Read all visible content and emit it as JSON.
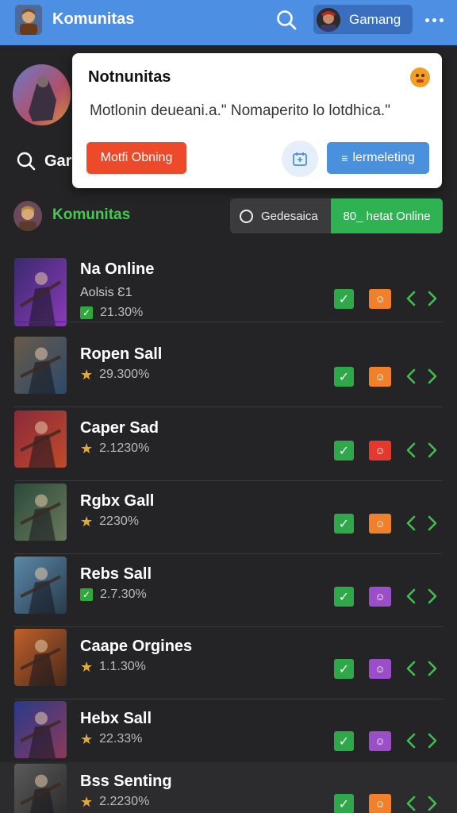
{
  "header": {
    "title": "Komunitas",
    "search_icon": "search-icon",
    "account_label": "Gamang",
    "more_icon": "more-horizontal-icon",
    "color": "#4d8fe3"
  },
  "background_search": {
    "text": "Gar"
  },
  "popup": {
    "title": "Notnunitas",
    "message": "Motlonin deueani.a.\" Nomaperito lo lotdhica.\"",
    "primary_button": "Motfi Obning",
    "calendar_icon": "calendar-icon",
    "secondary_button": "lermeleting",
    "secondary_icon": "list-icon"
  },
  "community": {
    "title": "Komunitas",
    "toggle_left": "Gedesaica",
    "toggle_right": "80_ hetat Online",
    "accent": "#46c954"
  },
  "rows": [
    {
      "name": "Na Online",
      "subtitle": "Aolsis Ɛ1",
      "stat": "21.30%",
      "stat_icon": "check",
      "user_color": "#f0802a",
      "thumb": [
        "#3a2a6e",
        "#8a3ab8"
      ]
    },
    {
      "name": "Ropen Sall",
      "subtitle": "",
      "stat": "29.300%",
      "stat_icon": "star",
      "user_color": "#f0802a",
      "thumb": [
        "#6a5a4a",
        "#2a4a6a"
      ]
    },
    {
      "name": "Caper Sad",
      "subtitle": "",
      "stat": "2.1230%",
      "stat_icon": "star",
      "user_color": "#e53930",
      "thumb": [
        "#8a2a3a",
        "#c04a2a"
      ]
    },
    {
      "name": "Rgbx Gall",
      "subtitle": "",
      "stat": "2230%",
      "stat_icon": "star",
      "user_color": "#f0802a",
      "thumb": [
        "#2a4a3a",
        "#6a7a5a"
      ]
    },
    {
      "name": "Rebs Sall",
      "subtitle": "",
      "stat": "2.7.30%",
      "stat_icon": "check",
      "user_color": "#9a4ec8",
      "thumb": [
        "#5a8aaa",
        "#2a3a4a"
      ]
    },
    {
      "name": "Caape Orgines",
      "subtitle": "",
      "stat": "1.1.30%",
      "stat_icon": "star",
      "user_color": "#9a4ec8",
      "thumb": [
        "#c0602a",
        "#4a2a1a"
      ]
    },
    {
      "name": "Hebx Sall",
      "subtitle": "",
      "stat": "22.33%",
      "stat_icon": "star",
      "user_color": "#9a4ec8",
      "thumb": [
        "#2a3a8a",
        "#8a3a5a"
      ]
    },
    {
      "name": "Bss Senting",
      "subtitle": "",
      "stat": "2.2230%",
      "stat_icon": "star",
      "user_color": "#f0802a",
      "thumb": [
        "#5a5a5a",
        "#2a2a2a"
      ]
    }
  ]
}
